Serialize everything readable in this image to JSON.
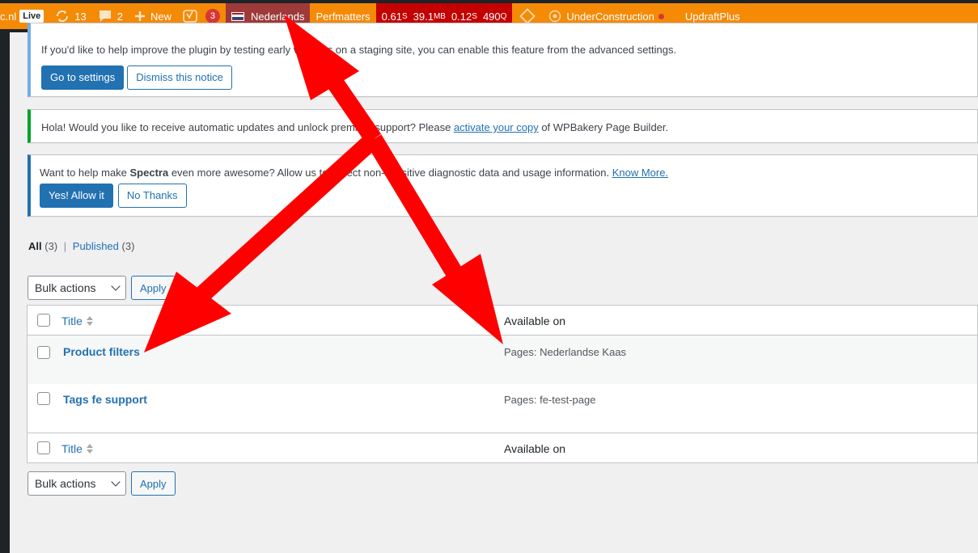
{
  "adminbar": {
    "site_suffix": "c.nl",
    "live_badge": "Live",
    "updates_count": "13",
    "comments_count": "2",
    "new_label": "New",
    "yoast_count": "3",
    "language": "Nederlands",
    "perfmatters": "Perfmatters",
    "qm": {
      "time1": "0.61",
      "time1_unit": "S",
      "memory": "39.1",
      "memory_unit": "MB",
      "time2": "0.12",
      "time2_unit": "S",
      "queries": "490",
      "queries_unit": "Q"
    },
    "under_construction": "UnderConstruction",
    "updraft": "UpdraftPlus"
  },
  "notices": {
    "beta": {
      "text": "If you'd like to help improve the plugin by testing early versions on a staging site, you can enable this feature from the advanced settings.",
      "settings_button": "Go to settings",
      "dismiss_button": "Dismiss this notice"
    },
    "wpbakery": {
      "text_before": "Hola! Would you like to receive automatic updates and unlock premium support? Please ",
      "link": "activate your copy",
      "text_after": " of WPBakery Page Builder."
    },
    "spectra": {
      "text_before": "Want to help make ",
      "brand": "Spectra",
      "text_after": " even more awesome? Allow us to collect non-sensitive diagnostic data and usage information. ",
      "link": "Know More.",
      "allow_button": "Yes! Allow it",
      "deny_button": "No Thanks"
    }
  },
  "views": {
    "all_label": "All",
    "all_count": "(3)",
    "separator": "|",
    "published_label": "Published",
    "published_count": "(3)"
  },
  "bulk": {
    "select_label": "Bulk actions",
    "apply_label": "Apply"
  },
  "table": {
    "col_title": "Title",
    "col_available": "Available on",
    "rows": [
      {
        "title": "Product filters",
        "available": "Pages: Nederlandse Kaas"
      },
      {
        "title": "Tags fe support",
        "available": "Pages: fe-test-page"
      }
    ]
  },
  "colors": {
    "adminbar_bg": "#f58a07",
    "language_bg": "#9e3a3a",
    "qm_bg": "#c40000",
    "annotation_arrow": "#ff0000",
    "primary_button": "#2271b1"
  }
}
